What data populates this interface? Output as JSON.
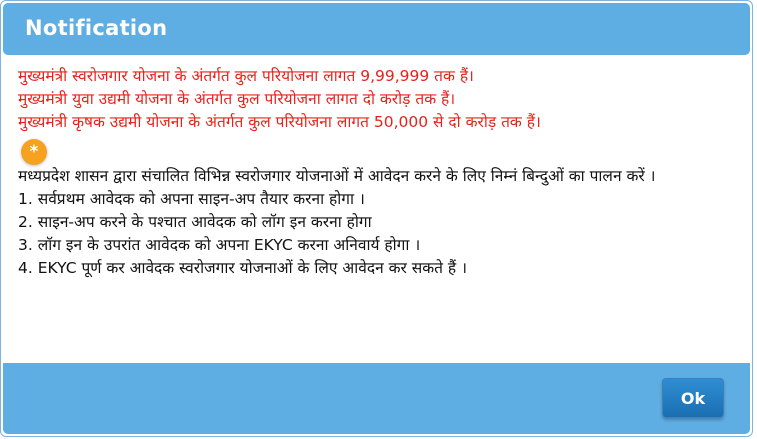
{
  "dialog": {
    "title": "Notification"
  },
  "highlights": [
    "मुख्यमंत्री स्वरोजगार योजना के अंतर्गत कुल परियोजना लागत 9,99,999 तक हैं।",
    "मुख्यमंत्री युवा उद्यमी योजना के अंतर्गत कुल परियोजना लागत दो करोड़ तक हैं।",
    "मुख्यमंत्री कृषक उद्यमी योजना के अंतर्गत कुल परियोजना लागत 50,000 से दो करोड़ तक हैं।"
  ],
  "badge": {
    "symbol": "*",
    "icon": "star-badge-icon",
    "color": "#f6a21e"
  },
  "instructions": {
    "intro": "मध्यप्रदेश शासन द्वारा संचालित विभिन्न स्वरोजगार योजनाओं में आवेदन करने के लिए निम्नं बिन्दुओं का पालन करें ।",
    "steps": [
      "1. सर्वप्रथम आवेदक को अपना साइन-अप तैयार करना होगा ।",
      "2. साइन-अप करने के पश्चात आवेदक को लॉग इन करना होगा",
      "3. लॉग इन के उपरांत आवेदक को अपना EKYC करना अनिवार्य होगा ।",
      "4. EKYC पूर्ण कर आवेदक स्वरोजगार योजनाओं के लिए आवेदन कर सकते हैं ।"
    ]
  },
  "footer": {
    "ok_label": "Ok"
  },
  "colors": {
    "header": "#5faee3",
    "highlight_text": "#e8221b",
    "button": "#1f78bd"
  }
}
